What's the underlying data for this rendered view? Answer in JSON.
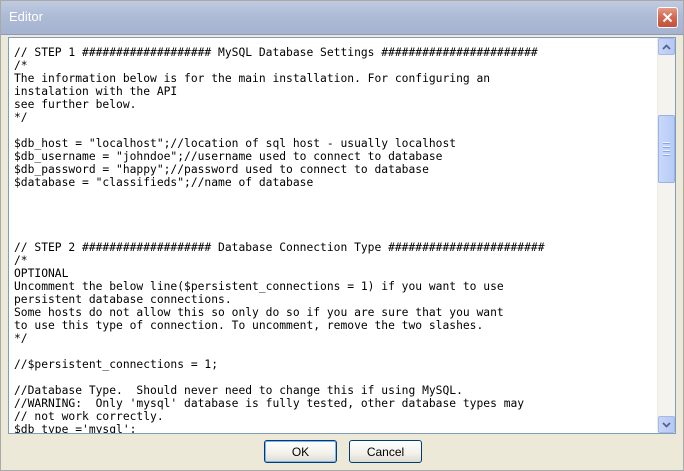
{
  "window": {
    "title": "Editor"
  },
  "editor": {
    "lines": [
      "// STEP 1 ################### MySQL Database Settings #######################",
      "/*",
      "The information below is for the main installation. For configuring an",
      "instalation with the API",
      "see further below.",
      "*/",
      "",
      "$db_host = \"localhost\";//location of sql host - usually localhost",
      "$db_username = \"johndoe\";//username used to connect to database",
      "$db_password = \"happy\";//password used to connect to database",
      "$database = \"classifieds\";//name of database",
      "",
      "",
      "",
      "",
      "// STEP 2 ################### Database Connection Type #######################",
      "/*",
      "OPTIONAL",
      "Uncomment the below line($persistent_connections = 1) if you want to use",
      "persistent database connections.",
      "Some hosts do not allow this so only do so if you are sure that you want",
      "to use this type of connection. To uncomment, remove the two slashes.",
      "*/",
      "",
      "//$persistent_connections = 1;",
      "",
      "//Database Type.  Should never need to change this if using MySQL.",
      "//WARNING:  Only 'mysql' database is fully tested, other database types may",
      "// not work correctly.",
      "$db_type ='mysql';"
    ]
  },
  "buttons": {
    "ok": "OK",
    "cancel": "Cancel"
  },
  "icons": {
    "close": "close-icon",
    "scroll_up": "arrow-up-icon",
    "scroll_down": "arrow-down-icon"
  }
}
